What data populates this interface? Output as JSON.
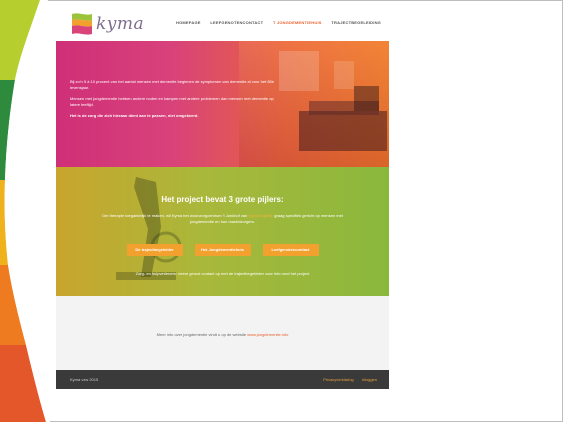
{
  "site": {
    "logo_text": "kyma",
    "nav": [
      {
        "label": "HOMEPAGE",
        "active": false
      },
      {
        "label": "LEEFGENOTENCONTACT",
        "active": false
      },
      {
        "label": "T JONGDEMENTIEHUIS",
        "active": true
      },
      {
        "label": "TRAJECTBEGELEIDING",
        "active": false
      }
    ],
    "hero": {
      "p1": "Bij zo'n 5 à 10 procent van het aantal mensen met dementie beginnen de symptomen van dementie al voor het 65e levensjaar.",
      "p2": "Mensen met jongdementie hebben andere noden en kampen met andere problemen dan mensen met dementie op latere leeftijd.",
      "p3": "Het is de zorg die zich hieraan dient aan te passen, niet omgekeerd."
    },
    "pillars": {
      "title": "Het project bevat 3 grote pijlers:",
      "intro_pre": "Om therapie toegankelijk te maken, wil Kyma het woonzorgcentrum 't Jonkhof van",
      "intro_link": "Kyma Kapelle",
      "intro_post": "graag specifiek gericht op mensen met jongdementie en hun mantelzorgers.",
      "buttons": [
        "De trajectbegeleider",
        "Het Jongdementiehuis",
        "Leefgenotencontact"
      ],
      "note": "Zorg- en hulpverleners: neem gerust contact op met de trajectbegeleider voor info rond het project"
    },
    "info": {
      "text": "Meer info over jongdementie vindt u op de website",
      "link": "www.jongdementie.info"
    },
    "footer": {
      "copyright": "Kyma vzw 2015",
      "links": [
        "Privacyverklaring",
        "Inloggen"
      ]
    }
  }
}
